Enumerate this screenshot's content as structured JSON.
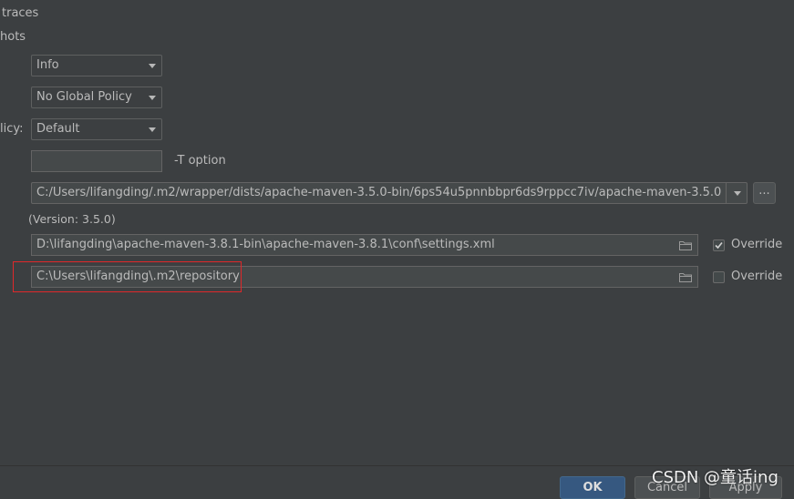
{
  "options": {
    "traces_label": "traces",
    "snapshots_label": "hots",
    "policy_label": "licy:"
  },
  "combos": {
    "log_level": "Info",
    "global_policy": "No Global Policy",
    "checksum_policy": "Default"
  },
  "threads": {
    "value": "",
    "option_label": "-T option"
  },
  "maven_home": {
    "path": "C:/Users/lifangding/.m2/wrapper/dists/apache-maven-3.5.0-bin/6ps54u5pnnbbpr6ds9rppcc7iv/apache-maven-3.5.0",
    "browse_label": "...",
    "version": "(Version: 3.5.0)"
  },
  "settings_file": {
    "path": "D:\\lifangding\\apache-maven-3.8.1-bin\\apache-maven-3.8.1\\conf\\settings.xml",
    "override_label": "Override",
    "override_checked": true
  },
  "local_repository": {
    "path": "C:\\Users\\lifangding\\.m2\\repository",
    "override_label": "Override",
    "override_checked": false
  },
  "footer": {
    "ok_label": "OK",
    "cancel_label": "Cancel",
    "apply_label": "Apply"
  },
  "watermark": "CSDN @童话ing",
  "colors": {
    "background": "#3c3f41",
    "primary_button": "#365880",
    "highlight_border": "#e0282a"
  }
}
